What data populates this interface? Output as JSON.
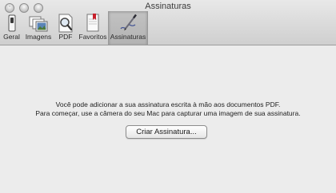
{
  "window": {
    "title": "Assinaturas"
  },
  "toolbar": {
    "items": [
      {
        "label": "Geral",
        "icon": "switch-icon",
        "selected": false
      },
      {
        "label": "Imagens",
        "icon": "photos-icon",
        "selected": false
      },
      {
        "label": "PDF",
        "icon": "pdf-magnifier-icon",
        "selected": false
      },
      {
        "label": "Favoritos",
        "icon": "bookmark-icon",
        "selected": false
      },
      {
        "label": "Assinaturas",
        "icon": "signature-pen-icon",
        "selected": true
      }
    ]
  },
  "main": {
    "message_line1": "Você pode adicionar a sua assinatura escrita à mão aos documentos PDF.",
    "message_line2": "Para começar, use a câmera do seu Mac para capturar uma imagem de sua assinatura.",
    "create_button_label": "Criar Assinatura..."
  },
  "colors": {
    "window_bg": "#ececec",
    "toolbar_selected_bg": "#bdbdbd"
  }
}
